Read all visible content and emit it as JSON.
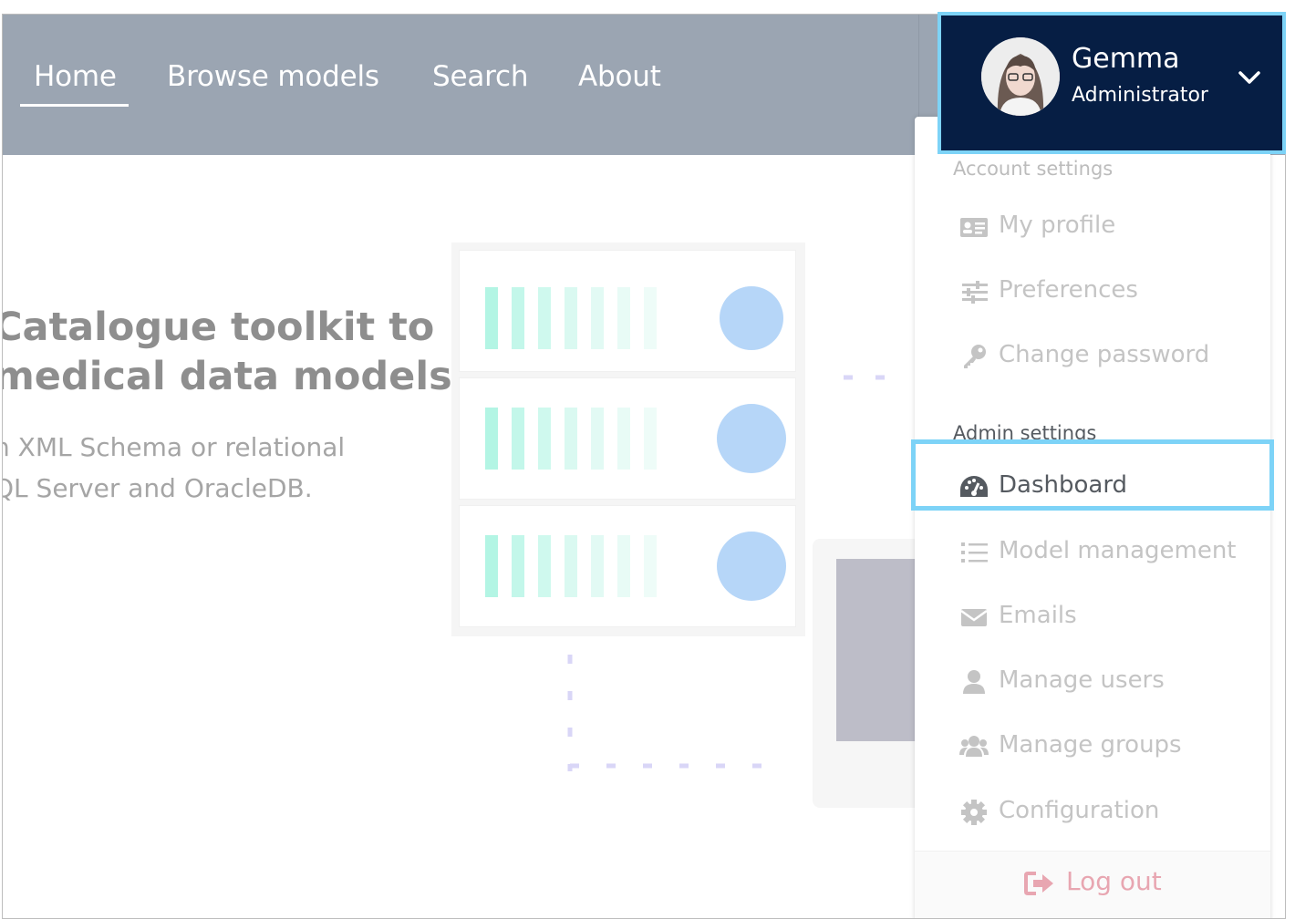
{
  "nav": {
    "home": "Home",
    "browse": "Browse models",
    "search": "Search",
    "about": "About"
  },
  "user": {
    "name": "Gemma",
    "role": "Administrator"
  },
  "hero": {
    "title_line1": "Catalogue toolkit to",
    "title_line2": "medical data models.",
    "sub_line1": "n XML Schema or relational",
    "sub_line2": "QL Server and OracleDB."
  },
  "menu": {
    "account_heading": "Account settings",
    "account_items": [
      {
        "label": "My profile",
        "icon": "id-card-icon"
      },
      {
        "label": "Preferences",
        "icon": "sliders-icon"
      },
      {
        "label": "Change password",
        "icon": "key-icon"
      }
    ],
    "admin_heading": "Admin settings",
    "admin_items": [
      {
        "label": "Dashboard",
        "icon": "dashboard-icon"
      },
      {
        "label": "Model management",
        "icon": "list-icon"
      },
      {
        "label": "Emails",
        "icon": "envelope-icon"
      },
      {
        "label": "Manage users",
        "icon": "user-icon"
      },
      {
        "label": "Manage groups",
        "icon": "users-icon"
      },
      {
        "label": "Configuration",
        "icon": "gear-icon"
      }
    ],
    "logout": "Log out"
  },
  "colors": {
    "navbar": "#9ba5b2",
    "user_block": "#061e44",
    "highlight": "#7dd3f7",
    "logout": "#e8a6b1"
  }
}
